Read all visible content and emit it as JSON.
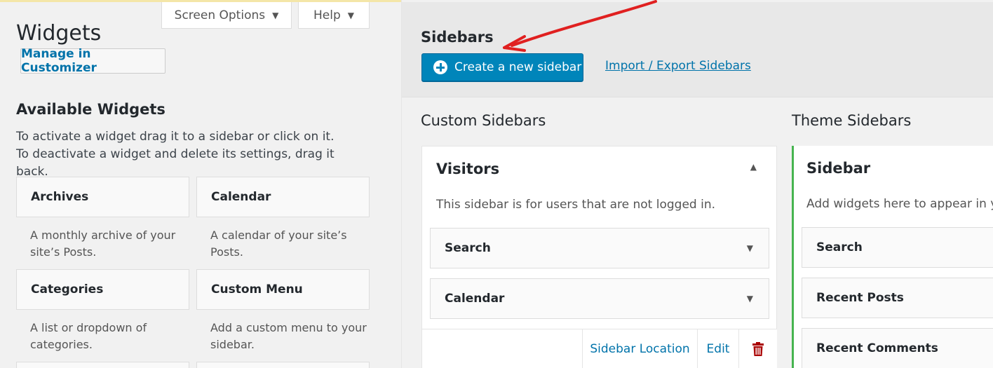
{
  "screen_tabs": {
    "screen_options": "Screen Options",
    "help": "Help"
  },
  "page": {
    "title": "Widgets",
    "manage_customizer": "Manage in Customizer"
  },
  "available": {
    "title": "Available Widgets",
    "description": "To activate a widget drag it to a sidebar or click on it. To deactivate a widget and delete its settings, drag it back.",
    "widgets": [
      {
        "name": "Archives",
        "desc": "A monthly archive of your site’s Posts."
      },
      {
        "name": "Calendar",
        "desc": "A calendar of your site’s Posts."
      },
      {
        "name": "Categories",
        "desc": "A list or dropdown of categories."
      },
      {
        "name": "Custom Menu",
        "desc": "Add a custom menu to your sidebar."
      }
    ]
  },
  "sidebars": {
    "title": "Sidebars",
    "create_button": "Create a new sidebar",
    "import_export": "Import / Export Sidebars",
    "custom_title": "Custom Sidebars",
    "theme_title": "Theme Sidebars",
    "custom": {
      "name": "Visitors",
      "description": "This sidebar is for users that are not logged in.",
      "widgets": [
        "Search",
        "Calendar"
      ],
      "footer": {
        "location": "Sidebar Location",
        "edit": "Edit"
      }
    },
    "theme": {
      "name": "Sidebar",
      "description": "Add widgets here to appear in yo",
      "widgets": [
        "Search",
        "Recent Posts",
        "Recent Comments"
      ]
    }
  },
  "colors": {
    "primary": "#0085ba",
    "link": "#0073aa",
    "active_border": "#46b450",
    "delete": "#aa0000",
    "annotation_arrow": "#e02020"
  }
}
